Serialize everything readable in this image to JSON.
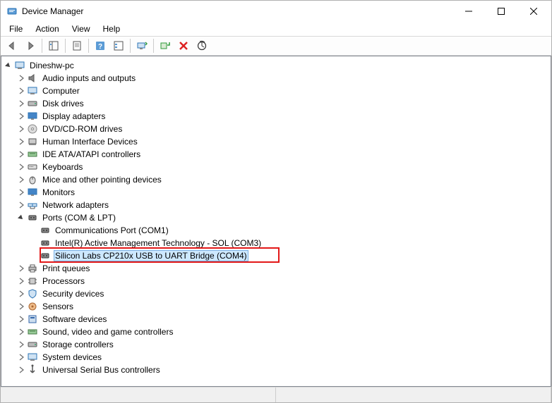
{
  "window": {
    "title": "Device Manager"
  },
  "menu": {
    "file": "File",
    "action": "Action",
    "view": "View",
    "help": "Help"
  },
  "tree": {
    "root": "Dineshw-pc",
    "categories": [
      "Audio inputs and outputs",
      "Computer",
      "Disk drives",
      "Display adapters",
      "DVD/CD-ROM drives",
      "Human Interface Devices",
      "IDE ATA/ATAPI controllers",
      "Keyboards",
      "Mice and other pointing devices",
      "Monitors",
      "Network adapters"
    ],
    "ports": {
      "label": "Ports (COM & LPT)",
      "children": [
        "Communications Port (COM1)",
        "Intel(R) Active Management Technology - SOL (COM3)",
        "Silicon Labs CP210x USB to UART Bridge (COM4)"
      ]
    },
    "categories_after": [
      "Print queues",
      "Processors",
      "Security devices",
      "Sensors",
      "Software devices",
      "Sound, video and game controllers",
      "Storage controllers",
      "System devices",
      "Universal Serial Bus controllers"
    ]
  }
}
